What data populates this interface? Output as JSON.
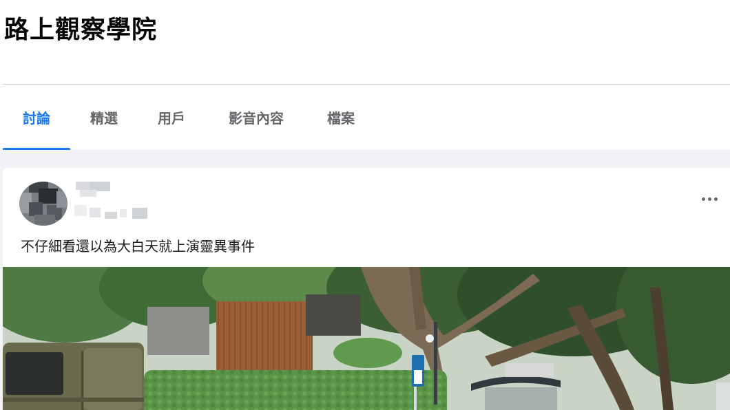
{
  "group": {
    "title": "路上觀察學院"
  },
  "tabs": [
    {
      "label": "討論",
      "active": true
    },
    {
      "label": "精選",
      "active": false
    },
    {
      "label": "用戶",
      "active": false
    },
    {
      "label": "影音內容",
      "active": false
    },
    {
      "label": "檔案",
      "active": false
    }
  ],
  "post": {
    "text": "不仔細看還以為大白天就上演靈異事件",
    "more_icon": "more-horizontal-icon",
    "image_description_icon": "photo"
  },
  "colors": {
    "accent": "#1877f2",
    "tab_inactive": "#65676b",
    "background": "#f0f2f5"
  }
}
